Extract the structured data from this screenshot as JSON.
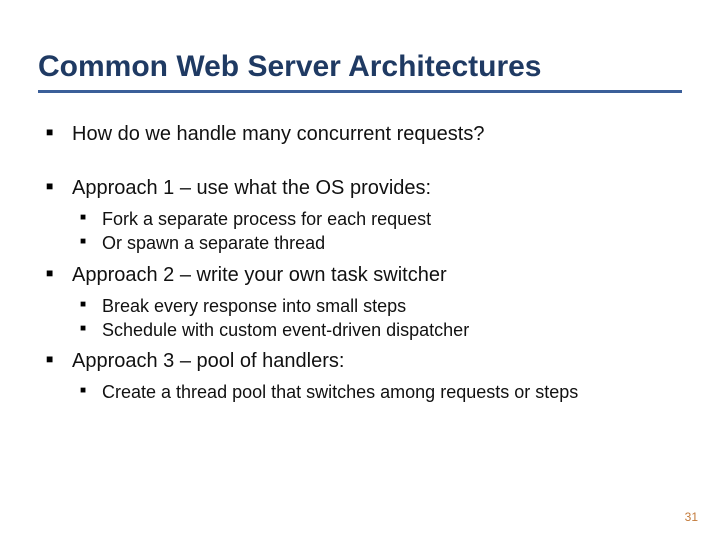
{
  "title": "Common Web Server Architectures",
  "bullets": {
    "intro": "How do we handle many concurrent requests?",
    "approach1": {
      "heading": "Approach 1 – use what the OS provides:",
      "sub": [
        "Fork a separate process for each request",
        "Or spawn a separate thread"
      ]
    },
    "approach2": {
      "heading": "Approach 2 – write your own task switcher",
      "sub": [
        "Break every response into small steps",
        "Schedule with custom event-driven dispatcher"
      ]
    },
    "approach3": {
      "heading": "Approach 3 – pool of handlers:",
      "sub": [
        "Create a thread pool that switches among requests or steps"
      ]
    }
  },
  "page_number": "31"
}
